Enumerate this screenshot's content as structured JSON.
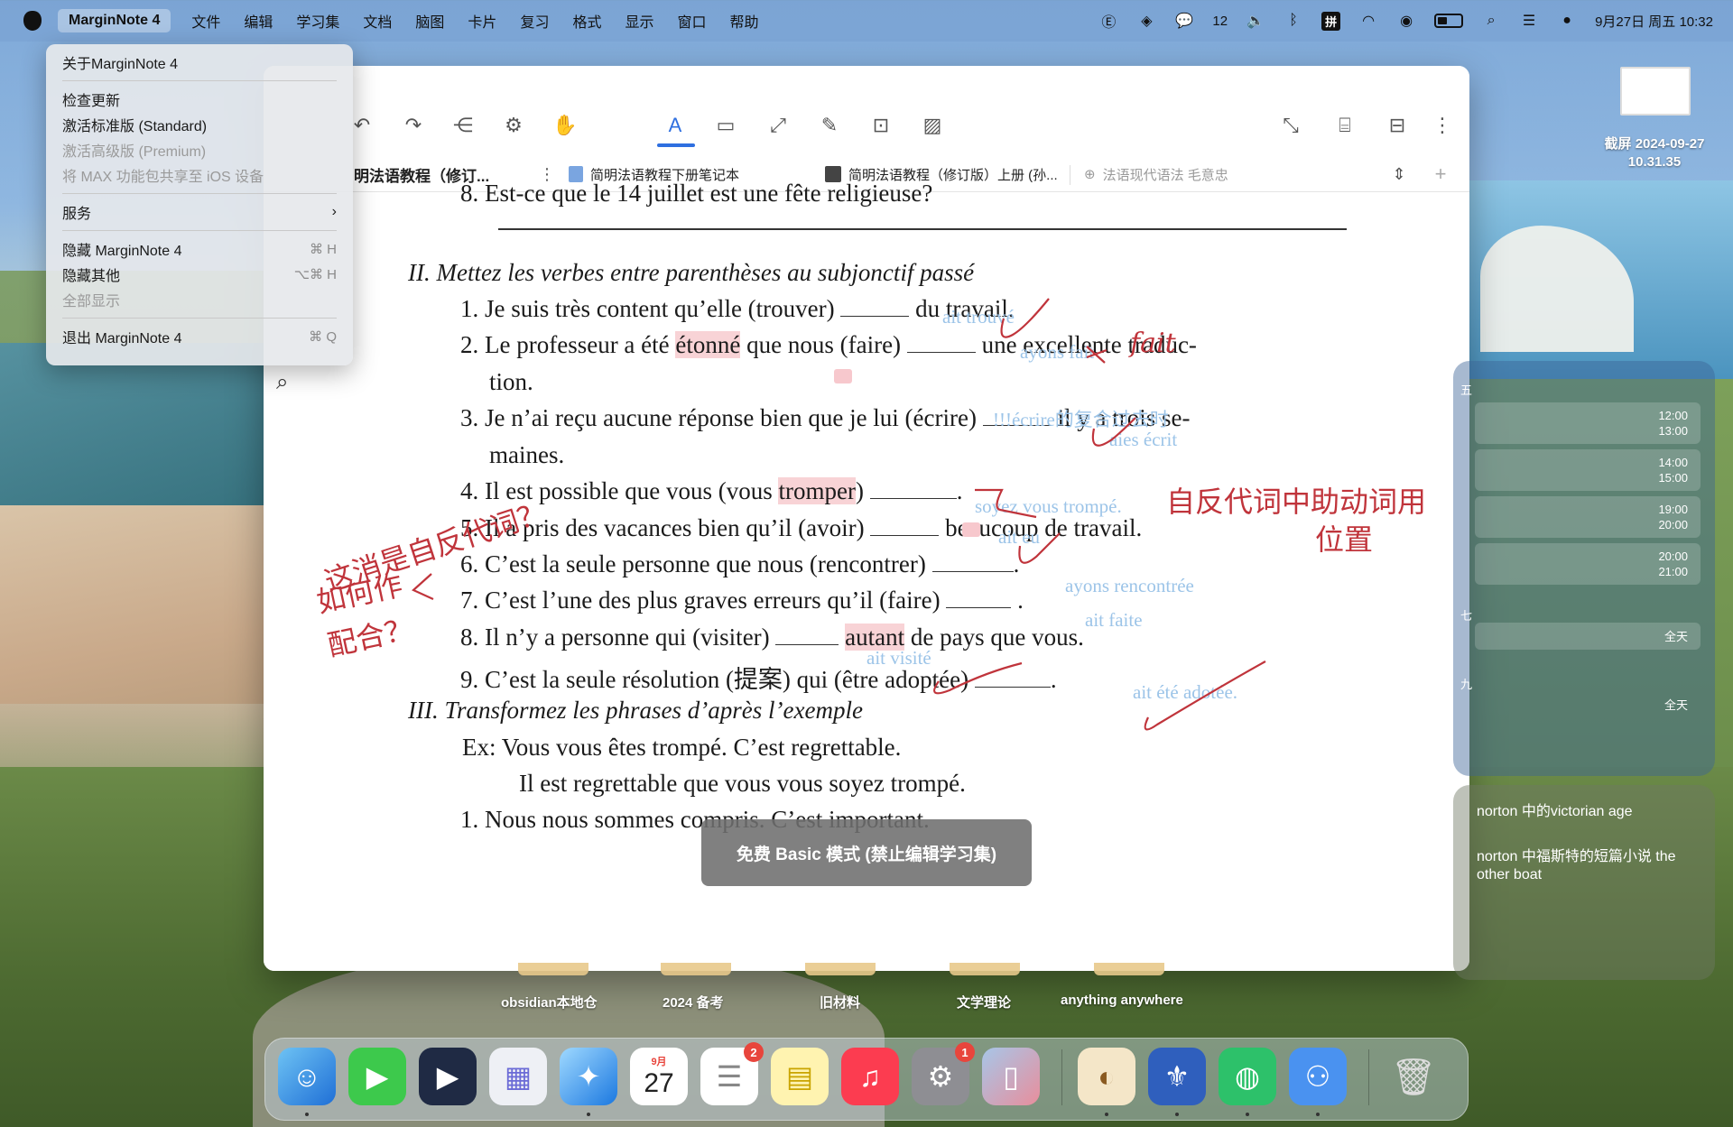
{
  "menubar": {
    "app_name": "MarginNote 4",
    "menus": [
      "文件",
      "编辑",
      "学习集",
      "文档",
      "脑图",
      "卡片",
      "复习",
      "格式",
      "显示",
      "窗口",
      "帮助"
    ],
    "wechat_count": "12",
    "input_method": "拼",
    "clock": "9月27日 周五 10:32"
  },
  "app_menu": {
    "about": "关于MarginNote 4",
    "check_update": "检查更新",
    "activate_standard": "激活标准版 (Standard)",
    "activate_premium": "激活高级版 (Premium)",
    "share_max": "将 MAX 功能包共享至 iOS 设备",
    "services": "服务",
    "hide_app": "隐藏 MarginNote 4",
    "hide_app_shortcut": "⌘ H",
    "hide_others": "隐藏其他",
    "hide_others_shortcut": "⌥⌘ H",
    "show_all": "全部显示",
    "quit": "退出 MarginNote 4",
    "quit_shortcut": "⌘ Q"
  },
  "tabs": {
    "tab1": "明法语教程（修订...",
    "tab2": "简明法语教程下册笔记本",
    "tab3": "简明法语教程（修订版）上册 (孙...",
    "tab4": "法语现代语法 毛意忠"
  },
  "doc": {
    "line_top": "8.  Est-ce que le 14 juillet est une fête religieuse?",
    "section2": "II.  Mettez les verbes entre parenthèses au subjonctif passé",
    "items": [
      {
        "num": "1.",
        "pre": "Je suis très content qu’elle (trouver)",
        "post": "du travail."
      },
      {
        "num": "2.",
        "pre": "Le professeur a été",
        "hl": "étonné",
        "mid": "que nous (faire)",
        "post": "une excellente traduc-"
      },
      {
        "num": "",
        "pre": "tion."
      },
      {
        "num": "3.",
        "pre": "Je n’ai reçu aucune réponse bien que je lui (écrire)",
        "post": "il y a trois se-"
      },
      {
        "num": "",
        "pre": "maines."
      },
      {
        "num": "4.",
        "pre": "Il est possible que vous (vous",
        "hl": "tromper",
        "mid": ")",
        "post": "."
      },
      {
        "num": "5.",
        "pre": "Il a pris des vacances bien qu’il (avoir)",
        "post": "beaucoup de travail."
      },
      {
        "num": "6.",
        "pre": "C’est la seule personne que nous (rencontrer)",
        "post": "."
      },
      {
        "num": "7.",
        "pre": "C’est l’une des plus graves erreurs qu’il (faire)",
        "post": "."
      },
      {
        "num": "8.",
        "pre": "Il n’y a personne qui (visiter)",
        "hl": "autant",
        "post": "de pays que vous."
      },
      {
        "num": "9.",
        "pre": "C’est la seule résolution (提案) qui (être adoptée)",
        "post": "."
      }
    ],
    "section3": "III.  Transformez les phrases d’après l’exemple",
    "ex_label": "Ex:",
    "ex_line1": "Vous vous êtes trompé. C’est regrettable.",
    "ex_line2": "Il est regrettable que vous vous soyez trompé.",
    "last_line": "1.  Nous nous sommes compris. C’est important.",
    "answers": {
      "a1": "ait trouvé",
      "a2": "ayons fait",
      "a3_hint": "!!!écrire的复合过去时",
      "a3": "aies écrit",
      "a4": "soyez vous trompé.",
      "a5": "ait eu",
      "a6": "ayons rencontrée",
      "a7": "ait faite",
      "a8": "ait visité",
      "a9": "ait été adotée."
    },
    "red_notes": {
      "fait": "fait",
      "reflexive": "自反代词中助动词用",
      "position": "位置",
      "side_1": "这消是自反代词？",
      "side_2": "如何作",
      "side_3": "配合？"
    }
  },
  "toast": "免费 Basic 模式 (禁止编辑学习集)",
  "screenshot": {
    "label_line1": "截屏 2024-09-27",
    "label_line2": "10.31.35"
  },
  "calendar": {
    "events": [
      {
        "start": "12:00",
        "end": "13:00"
      },
      {
        "start": "14:00",
        "end": "15:00"
      },
      {
        "start": "19:00",
        "end": "20:00"
      },
      {
        "start": "20:00",
        "end": "21:00"
      }
    ],
    "allday_1": "全天",
    "allday_2": "全天",
    "side_a": "五",
    "side_b": "七",
    "side_c": "九"
  },
  "notes": {
    "note1": "norton 中的victorian age",
    "note2": "norton 中福斯特的短篇小说 the other boat"
  },
  "desktop_folders": [
    "obsidian本地仓",
    "2024 备考",
    "旧材料",
    "文学理论",
    "anything anywhere"
  ],
  "dock": {
    "calendar_month": "9月",
    "calendar_day": "27",
    "reminders_badge": "2",
    "settings_badge": "1"
  }
}
